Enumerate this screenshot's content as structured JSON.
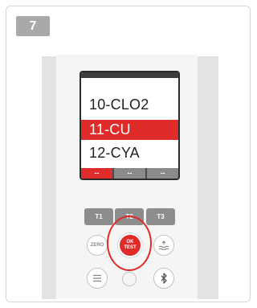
{
  "step": {
    "number": "7"
  },
  "display": {
    "rows": [
      "10-CLO2",
      "11-CU",
      "12-CYA"
    ],
    "selected_index": 1,
    "tabs": [
      "--",
      "--",
      "--"
    ],
    "active_tab_index": 0
  },
  "keys": {
    "t1": "T1",
    "t2": "T2",
    "t3": "T3",
    "zero": "ZERO",
    "ok_line1": "OK",
    "ok_line2": "TEST"
  },
  "colors": {
    "accent": "#e02b2b",
    "badge": "#a9a9a9",
    "key_gray": "#8d8d8d"
  },
  "icons": {
    "water": "water-wave-icon",
    "menu": "menu-icon",
    "bluetooth": "bluetooth-icon"
  }
}
